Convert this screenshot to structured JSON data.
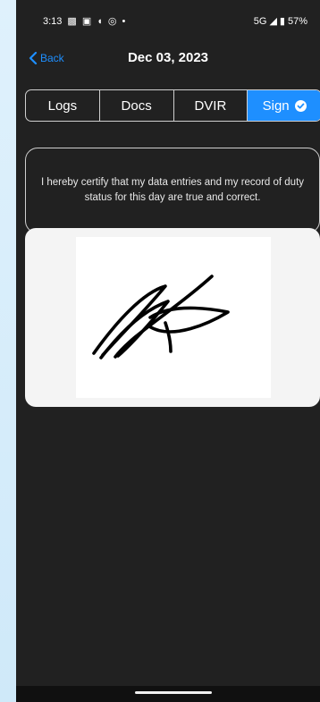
{
  "status_bar": {
    "time": "3:13",
    "network": "5G",
    "battery": "57%",
    "icons": [
      "teams-icon",
      "linkedin-icon",
      "shield-icon",
      "cast-icon",
      "dot-icon",
      "signal-icon",
      "battery-icon"
    ]
  },
  "nav": {
    "back_label": "Back",
    "title": "Dec 03, 2023"
  },
  "tabs": [
    {
      "label": "Logs",
      "active": false
    },
    {
      "label": "Docs",
      "active": false
    },
    {
      "label": "DVIR",
      "active": false
    },
    {
      "label": "Sign",
      "active": true
    }
  ],
  "certification_text": "I hereby certify that my data entries and my record of duty status for this day are true and correct.",
  "colors": {
    "accent": "#1e8fff",
    "background": "#212121",
    "border": "#cfcfcf"
  }
}
